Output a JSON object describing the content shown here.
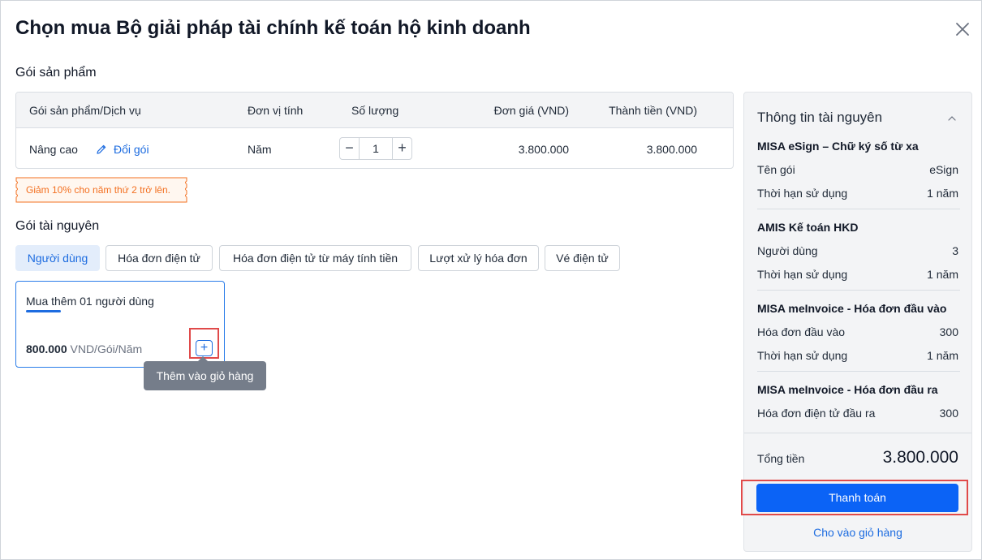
{
  "dialog": {
    "title": "Chọn mua Bộ giải pháp tài chính kế toán hộ kinh doanh"
  },
  "product_section": {
    "label": "Gói sản phẩm",
    "columns": [
      "Gói sản phẩm/Dịch vụ",
      "Đơn vị tính",
      "Số lượng",
      "Đơn giá (VND)",
      "Thành tiền (VND)"
    ],
    "row": {
      "name": "Nâng cao",
      "change_label": "Đổi gói",
      "unit": "Năm",
      "quantity": "1",
      "minus": "−",
      "plus": "+",
      "unit_price": "3.800.000",
      "total": "3.800.000"
    },
    "promo": "Giảm 10% cho năm thứ 2 trở lên."
  },
  "resource_section": {
    "label": "Gói tài nguyên",
    "tabs": [
      "Người dùng",
      "Hóa đơn điện tử",
      "Hóa đơn điện tử từ máy tính tiền",
      "Lượt xử lý hóa đơn",
      "Vé điện tử"
    ],
    "active_tab": "Người dùng",
    "card": {
      "title": "Mua thêm 01 người dùng",
      "price": "800.000",
      "price_unit": "VND/Gói/Năm",
      "add_symbol": "+"
    },
    "tooltip": "Thêm vào giỏ hàng"
  },
  "resource_info": {
    "title": "Thông tin tài nguyên",
    "groups": [
      {
        "title": "MISA eSign – Chữ ký số từ xa",
        "rows": [
          [
            "Tên gói",
            "eSign"
          ],
          [
            "Thời hạn sử dụng",
            "1 năm"
          ]
        ]
      },
      {
        "title": "AMIS Kế toán HKD",
        "rows": [
          [
            "Người dùng",
            "3"
          ],
          [
            "Thời hạn sử dụng",
            "1 năm"
          ]
        ]
      },
      {
        "title": "MISA meInvoice - Hóa đơn đầu vào",
        "rows": [
          [
            "Hóa đơn đầu vào",
            "300"
          ],
          [
            "Thời hạn sử dụng",
            "1 năm"
          ]
        ]
      },
      {
        "title": "MISA meInvoice - Hóa đơn đầu ra",
        "rows": [
          [
            "Hóa đơn điện tử đầu ra",
            "300"
          ]
        ]
      }
    ],
    "total_label": "Tổng tiền",
    "total_value": "3.800.000",
    "pay_label": "Thanh toán",
    "cart_label": "Cho vào giỏ hàng"
  },
  "colors": {
    "accent": "#1d6ce0",
    "primary_button": "#0b63f6",
    "promo": "#f37021",
    "highlight": "#e04a4a"
  },
  "icons": [
    "close-icon",
    "pencil-icon",
    "chevron-up-icon",
    "plus-icon"
  ]
}
